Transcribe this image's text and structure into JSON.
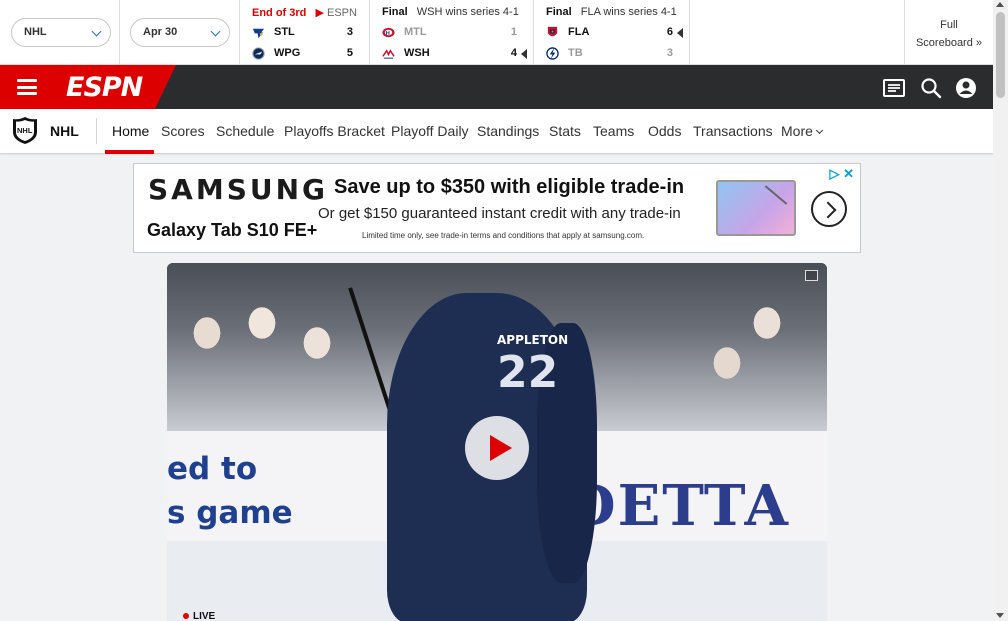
{
  "scoreboard": {
    "league_select": "NHL",
    "date_select": "Apr 30",
    "games": [
      {
        "status_bold": "End of 3rd",
        "status_text": "ESPN",
        "status_color": "#d00",
        "teams": [
          {
            "abbr": "STL",
            "score": "3",
            "winner": false
          },
          {
            "abbr": "WPG",
            "score": "5",
            "winner": false
          }
        ]
      },
      {
        "status_bold": "Final",
        "status_text": "WSH wins series 4-1",
        "teams": [
          {
            "abbr": "MTL",
            "score": "1",
            "winner": false
          },
          {
            "abbr": "WSH",
            "score": "4",
            "winner": true
          }
        ]
      },
      {
        "status_bold": "Final",
        "status_text": "FLA wins series 4-1",
        "teams": [
          {
            "abbr": "FLA",
            "score": "6",
            "winner": true
          },
          {
            "abbr": "TB",
            "score": "3",
            "winner": false
          }
        ]
      }
    ],
    "full_scoreboard_line1": "Full",
    "full_scoreboard_line2": "Scoreboard »"
  },
  "espn": {
    "logo": "ESPN",
    "brand_color": "#dd0000"
  },
  "subnav": {
    "league": "NHL",
    "items": [
      "Home",
      "Scores",
      "Schedule",
      "Playoffs Bracket",
      "Playoff Daily",
      "Standings",
      "Stats",
      "Teams",
      "Odds",
      "Transactions",
      "More"
    ]
  },
  "ad": {
    "brand": "SAMSUNG",
    "product": "Galaxy Tab S10 FE+",
    "headline": "Save up to $350 with eligible trade-in",
    "subhead": "Or get $150 guaranteed instant credit with any trade-in",
    "fine_print": "Limited time only, see trade-in terms and conditions that apply at samsung.com."
  },
  "hero": {
    "board_text_1": "ed to",
    "board_text_2": "s game",
    "board_text_3": "DETTA",
    "jersey_name": "APPLETON",
    "jersey_number": "22",
    "live_label": "LIVE"
  }
}
